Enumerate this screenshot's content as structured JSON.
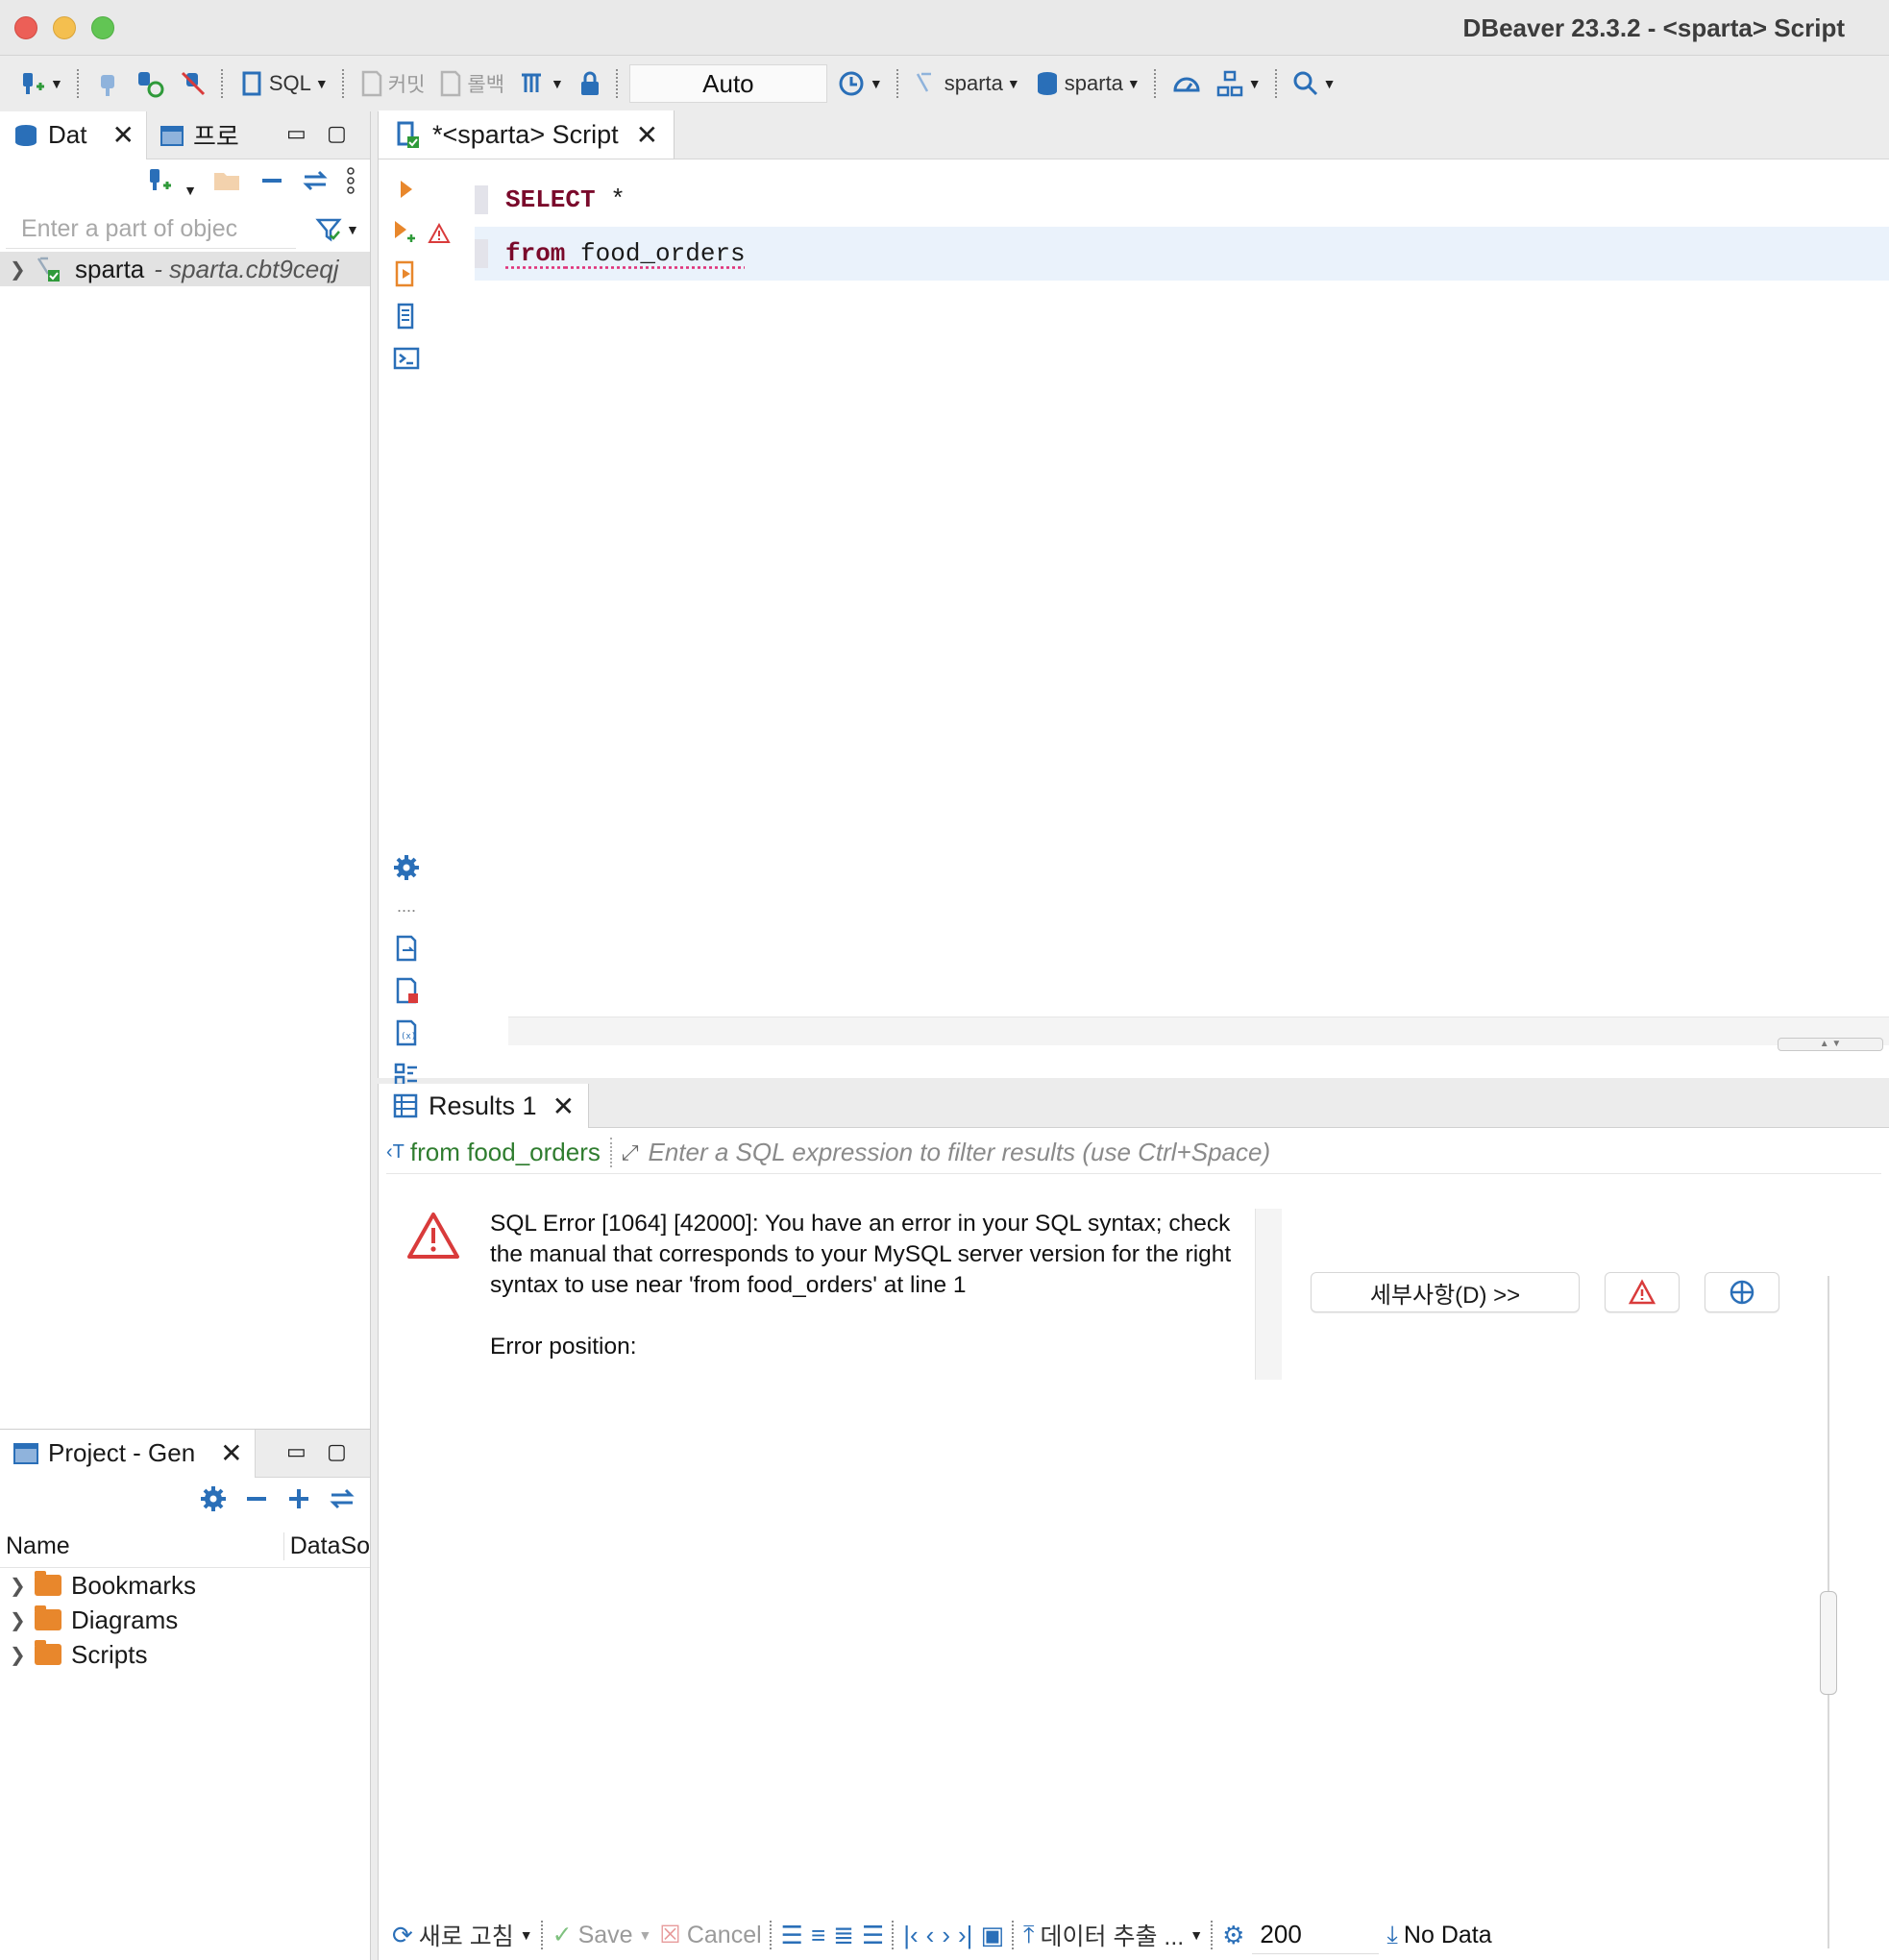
{
  "window": {
    "title": "DBeaver 23.3.2 - <sparta> Script"
  },
  "toolbar": {
    "sql_label": "SQL",
    "commit_label": "커밋",
    "rollback_label": "롤백",
    "transaction_mode": "Auto",
    "datasource": "sparta",
    "schema": "sparta"
  },
  "navigator": {
    "tab_db": "Dat",
    "tab_projects": "프로",
    "filter_placeholder": "Enter a part of objec",
    "tree": [
      {
        "label": "sparta",
        "detail": " - sparta.cbt9ceqj"
      }
    ]
  },
  "project": {
    "tab_label": "Project - Gen",
    "col_name": "Name",
    "col_datasource": "DataSo",
    "items": [
      {
        "label": "Bookmarks"
      },
      {
        "label": "Diagrams"
      },
      {
        "label": "Scripts"
      }
    ]
  },
  "editor": {
    "tab_label": "*<sparta> Script",
    "lines": [
      {
        "keyword": "SELECT",
        "rest": " *"
      },
      {
        "keyword": "from",
        "rest": " food_orders"
      }
    ]
  },
  "results": {
    "tab_label": "Results 1",
    "query_chip": "from food_orders",
    "filter_placeholder": "Enter a SQL expression to filter results (use Ctrl+Space)",
    "error_message": "SQL Error [1064] [42000]: You have an error in your SQL syntax; check the manual that corresponds to your MySQL server version for the right syntax to use near 'from food_orders' at line 1\n\nError position:",
    "details_button": "세부사항(D) >>",
    "bottom": {
      "refresh": "새로 고침",
      "save": "Save",
      "cancel": "Cancel",
      "export": "데이터 추출 ...",
      "fetch_size": "200",
      "status": "No Data"
    }
  },
  "colors": {
    "accent": "#2a6fb8",
    "keyword": "#7a0a2b",
    "error": "#d93b3b",
    "chip_green": "#2f7d2f"
  }
}
